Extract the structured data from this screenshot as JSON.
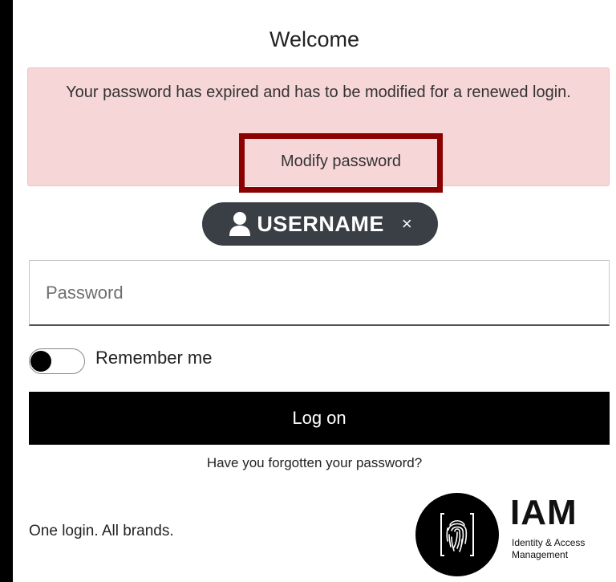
{
  "header": {
    "title": "Welcome"
  },
  "alert": {
    "message": "Your password has expired and has to be modified for a renewed login.",
    "link_label": "Modify password",
    "highlight_color": "#8b0000",
    "background_color": "#f7d6d8"
  },
  "user_chip": {
    "icon": "user-icon",
    "username": "USERNAME",
    "close_label": "×"
  },
  "password": {
    "placeholder": "Password",
    "value": ""
  },
  "remember": {
    "label": "Remember me",
    "checked": false
  },
  "logon": {
    "label": "Log on"
  },
  "forgot": {
    "label": "Have you forgotten your password?"
  },
  "footer": {
    "tagline": "One login. All brands.",
    "logo_title": "IAM",
    "logo_subtitle": "Identity & Access Management",
    "logo_icon": "fingerprint-icon"
  }
}
